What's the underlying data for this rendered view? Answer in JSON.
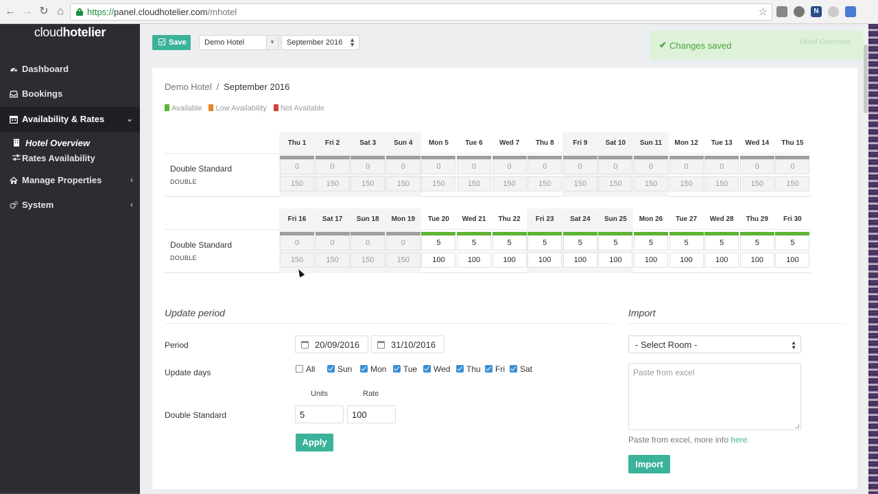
{
  "browser": {
    "url_scheme": "https://",
    "url_host": "panel.cloudhotelier.com",
    "url_path": "/mhotel",
    "ext_badge": "N"
  },
  "sidebar": {
    "brand_light": "cloud",
    "brand_bold": "hotelier",
    "items": [
      {
        "label": "Dashboard",
        "icon": "dashboard-icon"
      },
      {
        "label": "Bookings",
        "icon": "inbox-icon"
      },
      {
        "label": "Availability & Rates",
        "icon": "calendar-icon",
        "arrow": "⌄"
      },
      {
        "label": "Manage Properties",
        "icon": "home-icon",
        "arrow": "‹"
      },
      {
        "label": "System",
        "icon": "cogs-icon",
        "arrow": "‹"
      }
    ],
    "subitems": [
      {
        "label": "Hotel Overview",
        "icon": "building-icon"
      },
      {
        "label": "Rates Availability",
        "icon": "sliders-icon"
      }
    ]
  },
  "toolbar": {
    "save_label": "Save",
    "hotel": "Demo Hotel",
    "month": "September 2016"
  },
  "toast": {
    "message": "Changes saved",
    "ghost_label": "Hotel Overview"
  },
  "breadcrumb": {
    "link": "Demo Hotel",
    "separator": "/",
    "current": "September 2016"
  },
  "legend": [
    {
      "label": "Available",
      "color": "#5cb531"
    },
    {
      "label": "Low Availability",
      "color": "#e8872a"
    },
    {
      "label": "Not Available",
      "color": "#d0413c"
    }
  ],
  "colors": {
    "available": "#5cb531",
    "not_available": "#9e9e9e",
    "accent": "#3bb39a"
  },
  "grids": [
    {
      "room": "Double Standard",
      "code": "DOUBLE",
      "days": [
        {
          "label": "Thu 1",
          "units": "0",
          "rate": "150",
          "status": "na",
          "weekend": true
        },
        {
          "label": "Fri 2",
          "units": "0",
          "rate": "150",
          "status": "na",
          "weekend": true
        },
        {
          "label": "Sat 3",
          "units": "0",
          "rate": "150",
          "status": "na",
          "weekend": true
        },
        {
          "label": "Sun 4",
          "units": "0",
          "rate": "150",
          "status": "na",
          "weekend": true
        },
        {
          "label": "Mon 5",
          "units": "0",
          "rate": "150",
          "status": "na",
          "weekend": false
        },
        {
          "label": "Tue 6",
          "units": "0",
          "rate": "150",
          "status": "na",
          "weekend": false
        },
        {
          "label": "Wed 7",
          "units": "0",
          "rate": "150",
          "status": "na",
          "weekend": false
        },
        {
          "label": "Thu 8",
          "units": "0",
          "rate": "150",
          "status": "na",
          "weekend": false
        },
        {
          "label": "Fri 9",
          "units": "0",
          "rate": "150",
          "status": "na",
          "weekend": true
        },
        {
          "label": "Sat 10",
          "units": "0",
          "rate": "150",
          "status": "na",
          "weekend": true
        },
        {
          "label": "Sun 11",
          "units": "0",
          "rate": "150",
          "status": "na",
          "weekend": true
        },
        {
          "label": "Mon 12",
          "units": "0",
          "rate": "150",
          "status": "na",
          "weekend": false
        },
        {
          "label": "Tue 13",
          "units": "0",
          "rate": "150",
          "status": "na",
          "weekend": false
        },
        {
          "label": "Wed 14",
          "units": "0",
          "rate": "150",
          "status": "na",
          "weekend": false
        },
        {
          "label": "Thu 15",
          "units": "0",
          "rate": "150",
          "status": "na",
          "weekend": false
        }
      ]
    },
    {
      "room": "Double Standard",
      "code": "DOUBLE",
      "days": [
        {
          "label": "Fri 16",
          "units": "0",
          "rate": "150",
          "status": "na",
          "weekend": true
        },
        {
          "label": "Sat 17",
          "units": "0",
          "rate": "150",
          "status": "na",
          "weekend": true
        },
        {
          "label": "Sun 18",
          "units": "0",
          "rate": "150",
          "status": "na",
          "weekend": true
        },
        {
          "label": "Mon 19",
          "units": "0",
          "rate": "150",
          "status": "na",
          "weekend": true
        },
        {
          "label": "Tue 20",
          "units": "5",
          "rate": "100",
          "status": "av",
          "weekend": false
        },
        {
          "label": "Wed 21",
          "units": "5",
          "rate": "100",
          "status": "av",
          "weekend": false
        },
        {
          "label": "Thu 22",
          "units": "5",
          "rate": "100",
          "status": "av",
          "weekend": false
        },
        {
          "label": "Fri 23",
          "units": "5",
          "rate": "100",
          "status": "av",
          "weekend": true
        },
        {
          "label": "Sat 24",
          "units": "5",
          "rate": "100",
          "status": "av",
          "weekend": true
        },
        {
          "label": "Sun 25",
          "units": "5",
          "rate": "100",
          "status": "av",
          "weekend": true
        },
        {
          "label": "Mon 26",
          "units": "5",
          "rate": "100",
          "status": "av",
          "weekend": false
        },
        {
          "label": "Tue 27",
          "units": "5",
          "rate": "100",
          "status": "av",
          "weekend": false
        },
        {
          "label": "Wed 28",
          "units": "5",
          "rate": "100",
          "status": "av",
          "weekend": false
        },
        {
          "label": "Thu 29",
          "units": "5",
          "rate": "100",
          "status": "av",
          "weekend": false
        },
        {
          "label": "Fri 30",
          "units": "5",
          "rate": "100",
          "status": "av",
          "weekend": false
        }
      ]
    }
  ],
  "update_period": {
    "title": "Update period",
    "period_label": "Period",
    "date_from": "20/09/2016",
    "date_to": "31/10/2016",
    "days_label": "Update days",
    "days": [
      {
        "label": "All",
        "checked": false
      },
      {
        "label": "Sun",
        "checked": true
      },
      {
        "label": "Mon",
        "checked": true
      },
      {
        "label": "Tue",
        "checked": true
      },
      {
        "label": "Wed",
        "checked": true
      },
      {
        "label": "Thu",
        "checked": true
      },
      {
        "label": "Fri",
        "checked": true
      },
      {
        "label": "Sat",
        "checked": true
      }
    ],
    "units_head": "Units",
    "rate_head": "Rate",
    "room_label": "Double Standard",
    "units_value": "5",
    "rate_value": "100",
    "apply_label": "Apply"
  },
  "import": {
    "title": "Import",
    "room_select": "- Select Room -",
    "paste_placeholder": "Paste from excel",
    "help_text": "Paste from excel, more info ",
    "help_link": "here.",
    "button_label": "Import"
  }
}
